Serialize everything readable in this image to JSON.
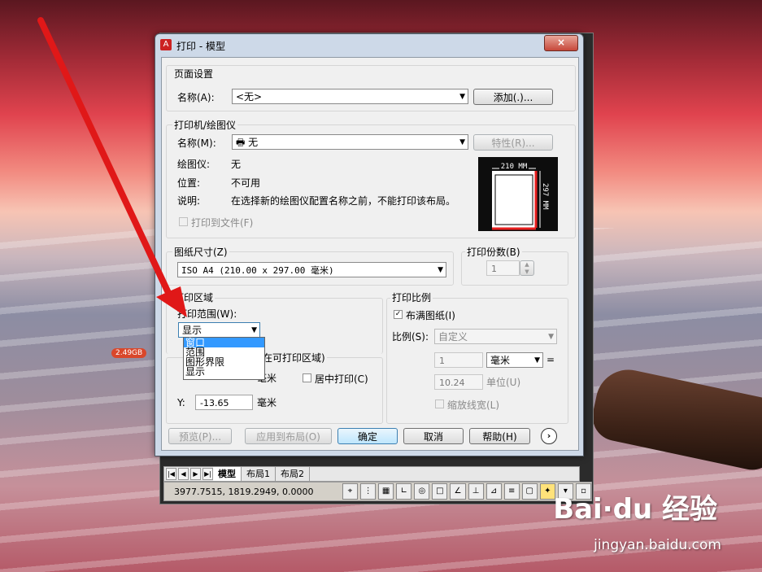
{
  "background": {
    "disk_badge": "2.49GB",
    "watermark_brand": "Bai·du 经验",
    "watermark_url": "jingyan.baidu.com"
  },
  "cad": {
    "tabs": [
      "模型",
      "布局1",
      "布局2"
    ],
    "coords": "3977.7515,  1819.2949,  0.0000"
  },
  "dialog": {
    "title": "打印 - 模型",
    "close_label": "×",
    "page_setup": {
      "group_label": "页面设置",
      "name_label": "名称(A):",
      "name_value": "<无>",
      "add_button": "添加(.)..."
    },
    "printer": {
      "group_label": "打印机/绘图仪",
      "name_label": "名称(M):",
      "name_value": "无",
      "properties_button": "特性(R)...",
      "plotter_label": "绘图仪:",
      "plotter_value": "无",
      "location_label": "位置:",
      "location_value": "不可用",
      "description_label": "说明:",
      "description_value": "在选择新的绘图仪配置名称之前，不能打印该布局。",
      "print_to_file": "打印到文件(F)",
      "preview_width": "210 MM",
      "preview_height": "297 MM"
    },
    "paper_size": {
      "group_label": "图纸尺寸(Z)",
      "value": "ISO A4 (210.00 x 297.00 毫米)"
    },
    "copies": {
      "group_label": "打印份数(B)",
      "value": "1"
    },
    "plot_area": {
      "group_label": "打印区域",
      "range_label": "打印范围(W):",
      "range_value": "显示",
      "options": [
        "窗口",
        "范围",
        "图形界限",
        "显示"
      ],
      "selected_option": "窗口"
    },
    "plot_offset": {
      "group_label_suffix": "在可打印区域)",
      "x_label": "X:",
      "y_label": "Y:",
      "y_value": "-13.65",
      "unit": "毫米",
      "center_label": "居中打印(C)"
    },
    "plot_scale": {
      "group_label": "打印比例",
      "fit_label": "布满图纸(I)",
      "scale_label": "比例(S):",
      "scale_value": "自定义",
      "value1": "1",
      "unit1": "毫米",
      "equals": "=",
      "value2": "10.24",
      "unit2": "单位(U)",
      "lineweights": "缩放线宽(L)"
    },
    "buttons": {
      "preview": "预览(P)...",
      "apply": "应用到布局(O)",
      "ok": "确定",
      "cancel": "取消",
      "help": "帮助(H)",
      "more": "›"
    }
  }
}
